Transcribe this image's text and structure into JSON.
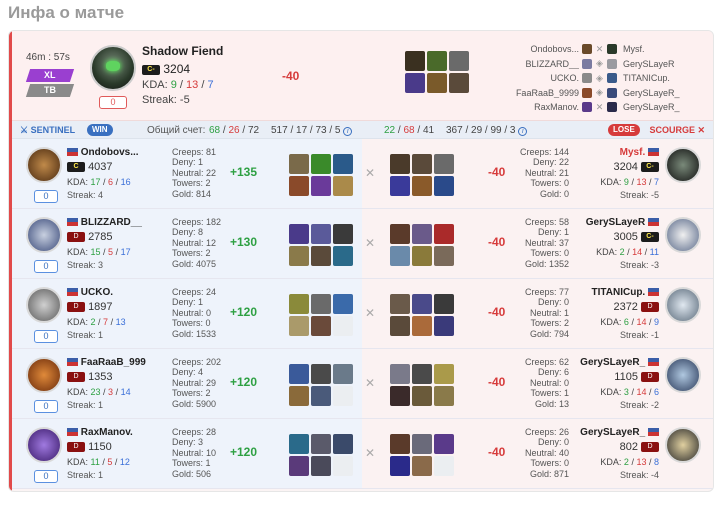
{
  "page_title": "Инфа о матче",
  "top": {
    "duration": "46m : 57s",
    "tags": [
      "XL",
      "TB"
    ],
    "hero_name": "Shadow Fiend",
    "rank": "C-",
    "rating": "3204",
    "kda_label": "KDA:",
    "kda": [
      "9",
      "13",
      "7"
    ],
    "streak": "Streak: -5",
    "badge": "0",
    "diff": "-40",
    "players": [
      {
        "left": "Ondobovs...",
        "right": "Mysf."
      },
      {
        "left": "BLIZZARD__",
        "right": "GerySLayeR"
      },
      {
        "left": "UCKO.",
        "right": "TITANICup."
      },
      {
        "left": "FaaRaaB_9999",
        "right": "GerySLayeR_"
      },
      {
        "left": "RaxManov.",
        "right": "GerySLayeR_"
      }
    ]
  },
  "bar": {
    "sentinel": "SENTINEL",
    "win": "WIN",
    "total_label": "Общий счет:",
    "left_score": [
      "68",
      "26",
      "72"
    ],
    "left_extra": "517 / 17 / 73 / 5",
    "right_score": [
      "22",
      "68",
      "41"
    ],
    "right_extra": "367 / 29 / 99 / 3",
    "lose": "LOSE",
    "scourge": "SCOURGE"
  },
  "rows": [
    {
      "l": {
        "name": "Ondobovs...",
        "rank": "C",
        "rating": "4037",
        "kda": [
          "17",
          "6",
          "16"
        ],
        "streak": "Streak: 4",
        "badge": "0",
        "creeps": "Creeps: 81",
        "deny": "Deny: 1",
        "neutral": "Neutral: 22",
        "towers": "Towers: 2",
        "gold": "Gold: 814",
        "diff": "+135"
      },
      "r": {
        "name": "Mysf.",
        "rank": "C-",
        "rating": "3204",
        "kda": [
          "9",
          "13",
          "7"
        ],
        "streak": "Streak: -5",
        "badge": "0",
        "creeps": "Creeps: 144",
        "deny": "Deny: 22",
        "neutral": "Neutral: 21",
        "towers": "Towers: 0",
        "gold": "Gold: 0",
        "diff": "-40"
      }
    },
    {
      "l": {
        "name": "BLIZZARD__",
        "rank": "D",
        "rating": "2785",
        "kda": [
          "15",
          "5",
          "17"
        ],
        "streak": "Streak: 3",
        "badge": "0",
        "creeps": "Creeps: 182",
        "deny": "Deny: 8",
        "neutral": "Neutral: 12",
        "towers": "Towers: 2",
        "gold": "Gold: 4075",
        "diff": "+130"
      },
      "r": {
        "name": "GerySLayeR",
        "rank": "C-",
        "rating": "3005",
        "kda": [
          "2",
          "14",
          "11"
        ],
        "streak": "Streak: -3",
        "badge": "0",
        "creeps": "Creeps: 58",
        "deny": "Deny: 1",
        "neutral": "Neutral: 37",
        "towers": "Towers: 0",
        "gold": "Gold: 1352",
        "diff": "-40"
      }
    },
    {
      "l": {
        "name": "UCKO.",
        "rank": "D",
        "rating": "1897",
        "kda": [
          "2",
          "7",
          "13"
        ],
        "streak": "Streak: 1",
        "badge": "0",
        "creeps": "Creeps: 24",
        "deny": "Deny: 1",
        "neutral": "Neutral: 0",
        "towers": "Towers: 0",
        "gold": "Gold: 1533",
        "diff": "+120"
      },
      "r": {
        "name": "TITANICup.",
        "rank": "D",
        "rating": "2372",
        "kda": [
          "6",
          "14",
          "9"
        ],
        "streak": "Streak: -1",
        "badge": "0",
        "creeps": "Creeps: 77",
        "deny": "Deny: 0",
        "neutral": "Neutral: 1",
        "towers": "Towers: 2",
        "gold": "Gold: 794",
        "diff": "-40"
      }
    },
    {
      "l": {
        "name": "FaaRaaB_999",
        "rank": "D",
        "rating": "1353",
        "kda": [
          "23",
          "3",
          "14"
        ],
        "streak": "Streak: 1",
        "badge": "0",
        "creeps": "Creeps: 202",
        "deny": "Deny: 4",
        "neutral": "Neutral: 29",
        "towers": "Towers: 2",
        "gold": "Gold: 5900",
        "diff": "+120"
      },
      "r": {
        "name": "GerySLayeR_",
        "rank": "D",
        "rating": "1105",
        "kda": [
          "3",
          "14",
          "6"
        ],
        "streak": "Streak: -2",
        "badge": "0",
        "creeps": "Creeps: 62",
        "deny": "Deny: 6",
        "neutral": "Neutral: 0",
        "towers": "Towers: 1",
        "gold": "Gold: 13",
        "diff": "-40"
      }
    },
    {
      "l": {
        "name": "RaxManov.",
        "rank": "D",
        "rating": "1150",
        "kda": [
          "11",
          "5",
          "12"
        ],
        "streak": "Streak: 1",
        "badge": "0",
        "creeps": "Creeps: 28",
        "deny": "Deny: 3",
        "neutral": "Neutral: 10",
        "towers": "Towers: 1",
        "gold": "Gold: 506",
        "diff": "+120"
      },
      "r": {
        "name": "GerySLayeR_",
        "rank": "D",
        "rating": "802",
        "kda": [
          "2",
          "13",
          "8"
        ],
        "streak": "Streak: -4",
        "badge": "0",
        "creeps": "Creeps: 26",
        "deny": "Deny: 0",
        "neutral": "Neutral: 40",
        "towers": "Towers: 0",
        "gold": "Gold: 871",
        "diff": "-40"
      }
    }
  ]
}
